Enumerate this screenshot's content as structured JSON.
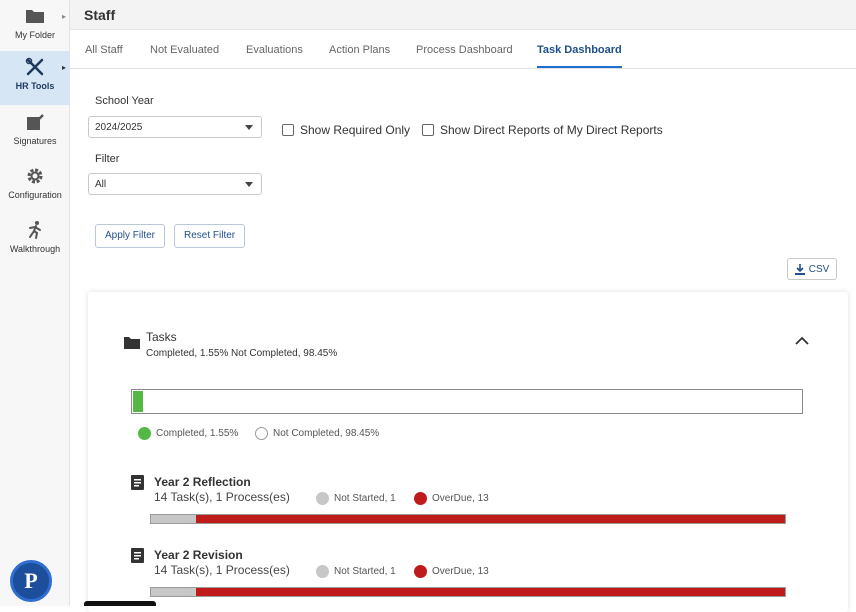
{
  "header": {
    "title": "Staff"
  },
  "sidebar": {
    "items": [
      {
        "label": "My Folder",
        "icon": "folder-icon"
      },
      {
        "label": "HR Tools",
        "icon": "tools-icon",
        "active": true
      },
      {
        "label": "Signatures",
        "icon": "signature-icon"
      },
      {
        "label": "Configuration",
        "icon": "gear-icon"
      },
      {
        "label": "Walkthrough",
        "icon": "walk-icon"
      }
    ]
  },
  "tabs": [
    {
      "label": "All Staff"
    },
    {
      "label": "Not Evaluated"
    },
    {
      "label": "Evaluations"
    },
    {
      "label": "Action Plans"
    },
    {
      "label": "Process Dashboard"
    },
    {
      "label": "Task Dashboard",
      "active": true
    }
  ],
  "filters": {
    "school_year_label": "School Year",
    "school_year_value": "2024/2025",
    "show_required_only": "Show Required Only",
    "show_direct_reports": "Show Direct Reports of My Direct Reports",
    "filter_label": "Filter",
    "filter_value": "All",
    "apply_label": "Apply Filter",
    "reset_label": "Reset Filter",
    "csv_label": "CSV"
  },
  "summary": {
    "title": "Tasks",
    "subtitle": "Completed, 1.55% Not Completed, 98.45%",
    "completed_fraction": 0.0155,
    "legend_completed": "Completed, 1.55%",
    "legend_not_completed": "Not Completed, 98.45%"
  },
  "tasks": [
    {
      "name": "Year 2 Reflection",
      "counts": "14 Task(s),   1 Process(es)",
      "not_started": "Not Started, 1",
      "overdue": "OverDue, 13",
      "not_started_fraction": 0.0714
    },
    {
      "name": "Year 2 Revision",
      "counts": "14 Task(s),   1 Process(es)",
      "not_started": "Not Started, 1",
      "overdue": "OverDue, 13",
      "not_started_fraction": 0.0714
    }
  ],
  "colors": {
    "completed": "#55b845",
    "not_completed": "#ffffff",
    "not_started": "#c7c7c7",
    "overdue": "#bf1b1b",
    "accent": "#1f6fd0"
  }
}
